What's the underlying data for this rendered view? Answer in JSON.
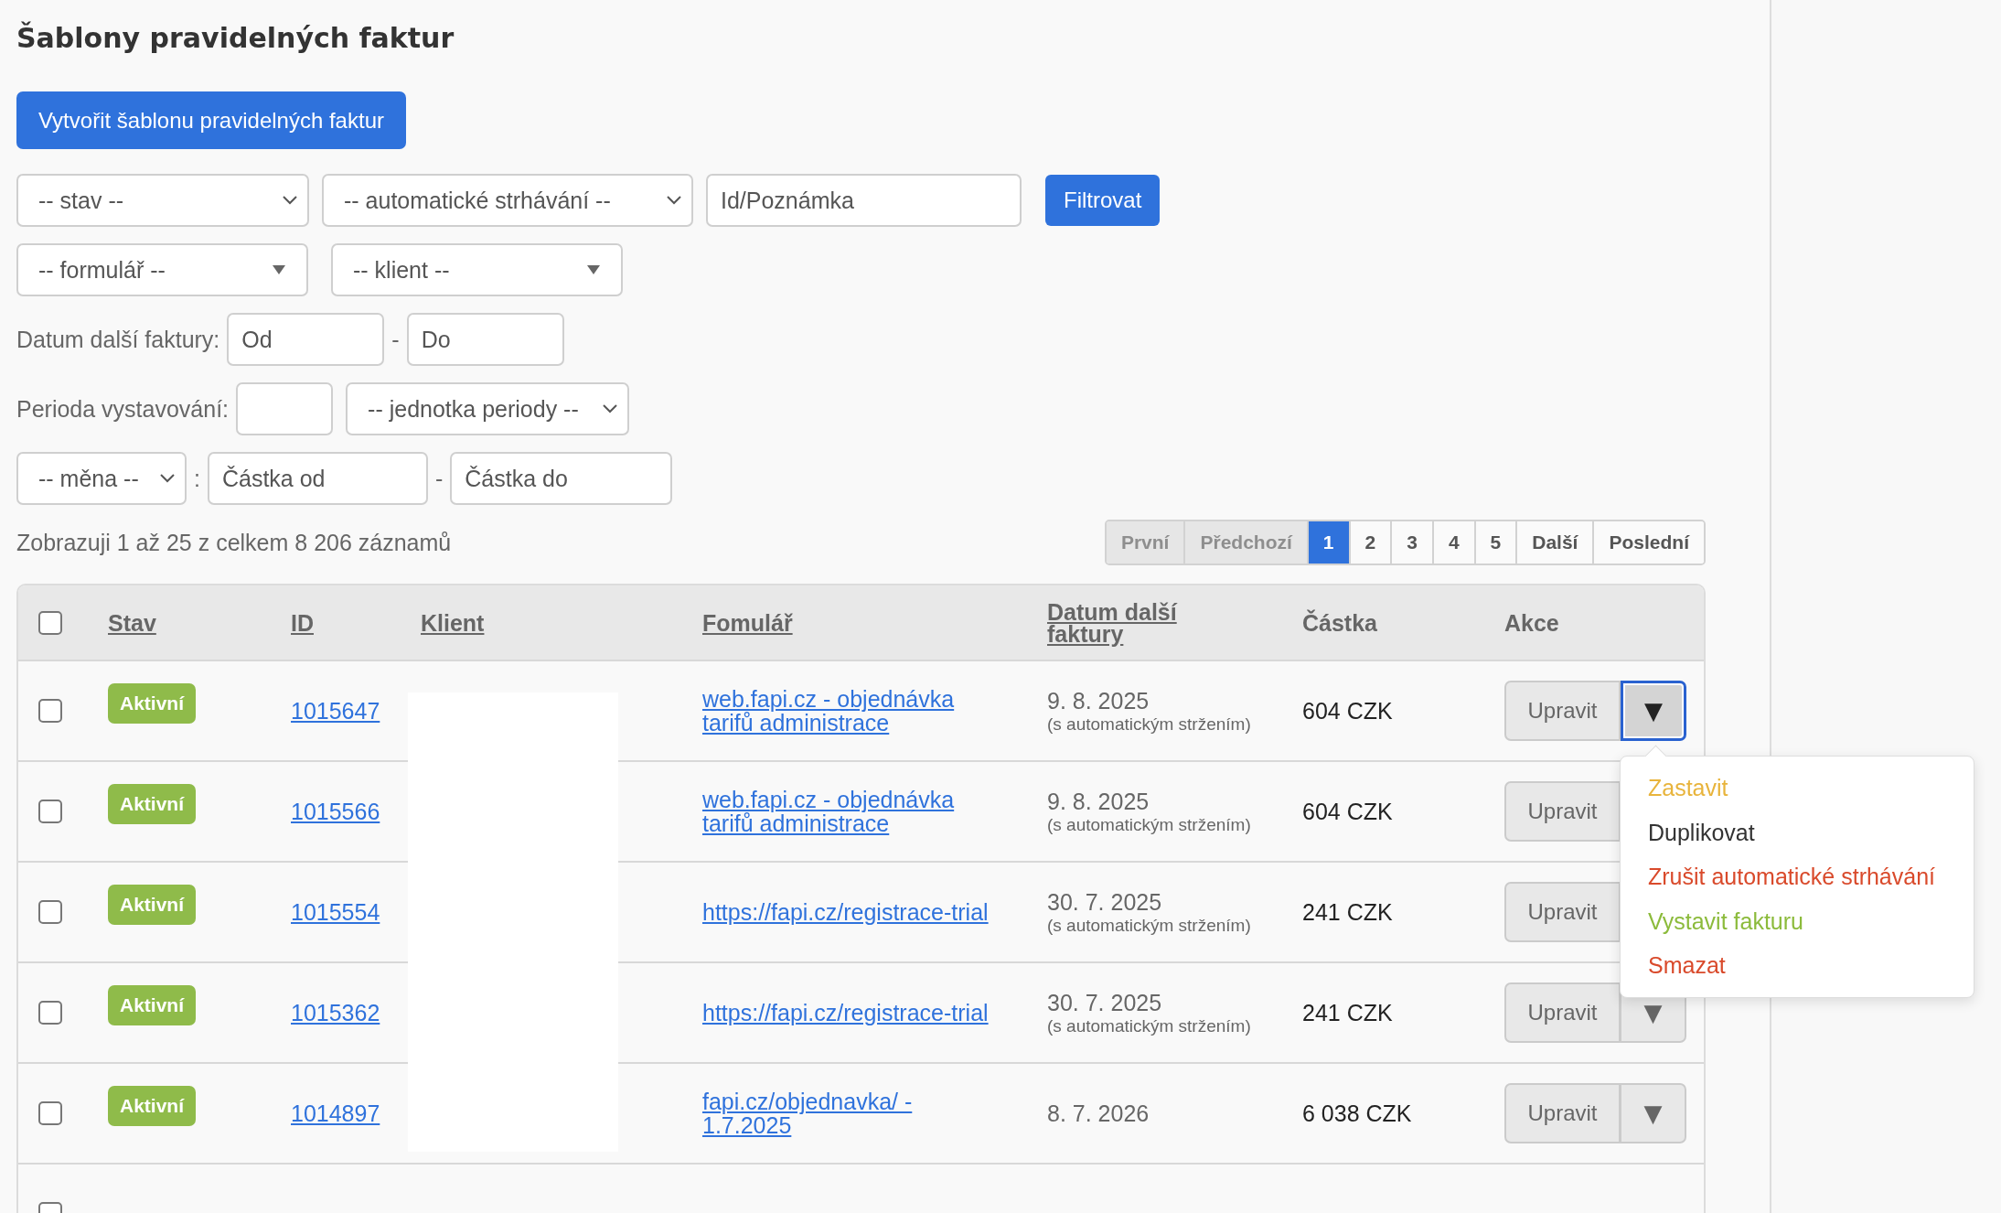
{
  "title": "Šablony pravidelných faktur",
  "create_button": "Vytvořit šablonu pravidelných faktur",
  "filter_rows": [
    {
      "items": [
        {
          "kind": "select",
          "text": "-- stav --"
        },
        {
          "kind": "select",
          "text": "-- automatické strhávání --"
        },
        {
          "kind": "input",
          "placeholder": "Id/Poznámka"
        },
        {
          "kind": "button",
          "text": "Filtrovat"
        }
      ]
    },
    {
      "items": [
        {
          "kind": "combo",
          "text": "-- formulář --"
        },
        {
          "kind": "combo",
          "text": "-- klient --"
        }
      ]
    },
    {
      "items": [
        {
          "kind": "label",
          "text": "Datum další faktury:"
        },
        {
          "kind": "input",
          "placeholder": "Od"
        },
        {
          "kind": "separator",
          "text": "-"
        },
        {
          "kind": "input",
          "placeholder": "Do"
        }
      ]
    },
    {
      "items": [
        {
          "kind": "label",
          "text": "Perioda vystavování:"
        },
        {
          "kind": "input"
        },
        {
          "kind": "select",
          "text": "-- jednotka periody --"
        }
      ]
    },
    {
      "items": [
        {
          "kind": "select",
          "text": "-- měna --"
        },
        {
          "kind": "separator",
          "text": ":"
        },
        {
          "kind": "input",
          "placeholder": "Částka od"
        },
        {
          "kind": "separator",
          "text": "-"
        },
        {
          "kind": "input",
          "placeholder": "Částka do"
        }
      ]
    }
  ],
  "record_count": "Zobrazuji 1 až 25 z celkem 8 206 záznamů",
  "pagination": [
    {
      "label": "První",
      "disabled": true,
      "selected": false
    },
    {
      "label": "Předchozí",
      "disabled": true,
      "selected": false
    },
    {
      "label": "1",
      "disabled": false,
      "selected": true
    },
    {
      "label": "2",
      "disabled": false,
      "selected": false
    },
    {
      "label": "3",
      "disabled": false,
      "selected": false
    },
    {
      "label": "4",
      "disabled": false,
      "selected": false
    },
    {
      "label": "5",
      "disabled": false,
      "selected": false
    },
    {
      "label": "Další",
      "disabled": false,
      "selected": false
    },
    {
      "label": "Poslední",
      "disabled": false,
      "selected": false
    }
  ],
  "table": {
    "select_all_checked": false,
    "client_redacted": true,
    "columns": [
      {
        "label": "Stav",
        "sortable": true
      },
      {
        "label": "ID",
        "sortable": true
      },
      {
        "label": "Klient",
        "sortable": true
      },
      {
        "label": "Fomulář",
        "sortable": true
      },
      {
        "label": "Datum další faktury",
        "sortable": true
      },
      {
        "label": "Částka",
        "sortable": false
      },
      {
        "label": "Akce",
        "sortable": false
      }
    ],
    "rows": [
      {
        "checked": false,
        "status": "Aktivní",
        "id": "1015647",
        "form": "web.fapi.cz - objednávka tarifů administrace",
        "date": "9. 8. 2025",
        "date_note": "(s automatickým stržením)",
        "amount": "604 CZK",
        "action": "Upravit",
        "toggle": "▼",
        "menu_open": true
      },
      {
        "checked": false,
        "status": "Aktivní",
        "id": "1015566",
        "form": "web.fapi.cz - objednávka tarifů administrace",
        "date": "9. 8. 2025",
        "date_note": "(s automatickým stržením)",
        "amount": "604 CZK",
        "action": "Upravit",
        "menu_open": false
      },
      {
        "checked": false,
        "status": "Aktivní",
        "id": "1015554",
        "form": "https://fapi.cz/registrace-trial",
        "date": "30. 7. 2025",
        "date_note": "(s automatickým stržením)",
        "amount": "241 CZK",
        "action": "Upravit",
        "menu_open": false
      },
      {
        "checked": false,
        "status": "Aktivní",
        "id": "1015362",
        "form": "https://fapi.cz/registrace-trial",
        "date": "30. 7. 2025",
        "date_note": "(s automatickým stržením)",
        "amount": "241 CZK",
        "action": "Upravit",
        "toggle": "▼",
        "menu_open": false
      },
      {
        "checked": false,
        "status": "Aktivní",
        "id": "1014897",
        "form": "fapi.cz/objednavka/ - 1.7.2025",
        "date": "8. 7. 2026",
        "amount": "6 038 CZK",
        "action": "Upravit",
        "toggle": "▼",
        "menu_open": false
      },
      {
        "checked": false
      }
    ]
  },
  "action_menu": [
    {
      "label": "Zastavit",
      "color": "#e8b43c"
    },
    {
      "label": "Duplikovat",
      "color": "#333333"
    },
    {
      "label": "Zrušit automatické strhávání",
      "color": "#d94a2b"
    },
    {
      "label": "Vystavit fakturu",
      "color": "#8cbb3c"
    },
    {
      "label": "Smazat",
      "color": "#d94a2b"
    }
  ]
}
